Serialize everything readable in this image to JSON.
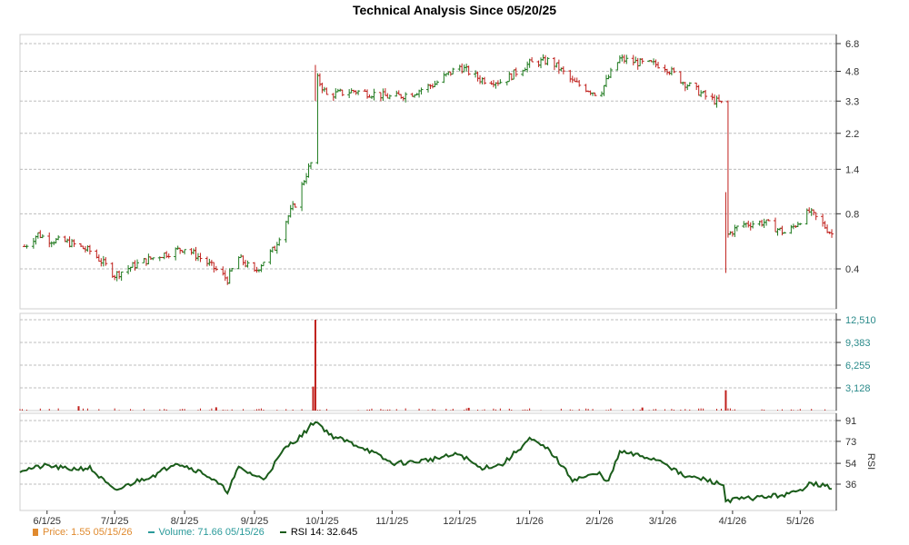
{
  "chart_data": {
    "title": "Technical Analysis Since 05/20/25",
    "panels": {
      "price": {
        "type": "ohlc",
        "scale": "log",
        "y_ticks": [
          6.8,
          4.8,
          3.3,
          2.2,
          1.4,
          0.8,
          0.4
        ],
        "grid": true,
        "axis_side": "right",
        "x_dates": [
          "6/1/25",
          "7/1/25",
          "8/1/25",
          "9/1/25",
          "10/1/25",
          "11/1/25",
          "12/1/25",
          "1/1/26",
          "2/1/26",
          "3/1/26",
          "4/1/26",
          "5/1/26"
        ],
        "anchors": [
          [
            "5/22/25",
            0.53
          ],
          [
            "5/28/25",
            0.62
          ],
          [
            "6/1/25",
            0.58
          ],
          [
            "6/10/25",
            0.56
          ],
          [
            "6/20/25",
            0.5
          ],
          [
            "7/1/25",
            0.37
          ],
          [
            "7/10/25",
            0.42
          ],
          [
            "7/20/25",
            0.47
          ],
          [
            "8/1/25",
            0.52
          ],
          [
            "8/10/25",
            0.44
          ],
          [
            "8/20/25",
            0.35
          ],
          [
            "8/25/25",
            0.46
          ],
          [
            "9/1/25",
            0.38
          ],
          [
            "9/10/25",
            0.52
          ],
          [
            "9/20/25",
            0.95
          ],
          [
            "9/27/25",
            1.6
          ],
          [
            "9/28/25",
            4.55
          ],
          [
            "10/3/25",
            3.55
          ],
          [
            "10/15/25",
            3.75
          ],
          [
            "10/25/25",
            3.6
          ],
          [
            "11/1/25",
            3.45
          ],
          [
            "11/10/25",
            3.65
          ],
          [
            "11/20/25",
            4.1
          ],
          [
            "12/1/25",
            5.1
          ],
          [
            "12/10/25",
            4.35
          ],
          [
            "12/20/25",
            4.2
          ],
          [
            "1/1/26",
            5.3
          ],
          [
            "1/10/26",
            5.5
          ],
          [
            "1/20/26",
            4.2
          ],
          [
            "2/1/26",
            3.55
          ],
          [
            "2/10/26",
            5.6
          ],
          [
            "2/20/26",
            5.3
          ],
          [
            "3/1/26",
            5.2
          ],
          [
            "3/10/26",
            4.2
          ],
          [
            "3/20/26",
            3.5
          ],
          [
            "3/28/26",
            3.15
          ],
          [
            "3/29/26",
            0.6
          ],
          [
            "4/5/26",
            0.7
          ],
          [
            "4/15/26",
            0.72
          ],
          [
            "4/25/26",
            0.62
          ],
          [
            "5/5/26",
            0.82
          ],
          [
            "5/15/26",
            0.62
          ]
        ],
        "color_up": "#1f7a1f",
        "color_down": "#c0201c"
      },
      "volume": {
        "type": "bar",
        "y_ticks": [
          12510,
          9383,
          6255,
          3128
        ],
        "ylim": [
          0,
          12510
        ],
        "spikes": [
          [
            "9/28/25",
            12510
          ],
          [
            "9/27/25",
            3300
          ],
          [
            "3/29/26",
            2800
          ],
          [
            "6/15/25",
            600
          ],
          [
            "8/15/25",
            450
          ],
          [
            "12/5/25",
            380
          ],
          [
            "2/20/26",
            420
          ]
        ],
        "color": "#c0201c"
      },
      "rsi": {
        "type": "line",
        "y_ticks": [
          91,
          73,
          54,
          36
        ],
        "ylim": [
          20,
          93
        ],
        "ylabel": "RSI",
        "anchors": [
          [
            "5/20/25",
            48
          ],
          [
            "6/1/25",
            52
          ],
          [
            "6/10/25",
            49
          ],
          [
            "6/20/25",
            50
          ],
          [
            "7/1/25",
            30
          ],
          [
            "7/10/25",
            38
          ],
          [
            "7/20/25",
            45
          ],
          [
            "7/28/25",
            55
          ],
          [
            "8/10/25",
            45
          ],
          [
            "8/20/25",
            30
          ],
          [
            "8/25/25",
            50
          ],
          [
            "9/5/25",
            40
          ],
          [
            "9/15/25",
            68
          ],
          [
            "9/22/25",
            78
          ],
          [
            "9/28/25",
            91
          ],
          [
            "10/5/25",
            78
          ],
          [
            "10/20/25",
            67
          ],
          [
            "11/1/25",
            54
          ],
          [
            "11/10/25",
            55
          ],
          [
            "11/20/25",
            58
          ],
          [
            "12/1/25",
            62
          ],
          [
            "12/10/25",
            50
          ],
          [
            "12/20/25",
            53
          ],
          [
            "1/1/26",
            75
          ],
          [
            "1/10/26",
            65
          ],
          [
            "1/20/26",
            40
          ],
          [
            "2/1/26",
            45
          ],
          [
            "2/5/26",
            38
          ],
          [
            "2/10/26",
            64
          ],
          [
            "2/20/26",
            60
          ],
          [
            "3/1/26",
            56
          ],
          [
            "3/10/26",
            43
          ],
          [
            "3/20/26",
            40
          ],
          [
            "3/28/26",
            35
          ],
          [
            "3/29/26",
            22
          ],
          [
            "4/10/26",
            24
          ],
          [
            "4/25/26",
            27
          ],
          [
            "5/1/26",
            30
          ],
          [
            "5/5/26",
            38
          ],
          [
            "5/10/26",
            35
          ],
          [
            "5/15/26",
            33
          ]
        ],
        "color": "#1a5c1a"
      }
    },
    "legend": [
      {
        "label": "Price: 1.55  05/15/26",
        "color": "#e08a2e",
        "swatch": "bar"
      },
      {
        "label": "Volume: 71.66  05/15/26",
        "color": "#2a9a9a",
        "swatch": "line"
      },
      {
        "label": "RSI 14: 32.645",
        "color": "#1a5c1a",
        "swatch": "line"
      }
    ]
  }
}
